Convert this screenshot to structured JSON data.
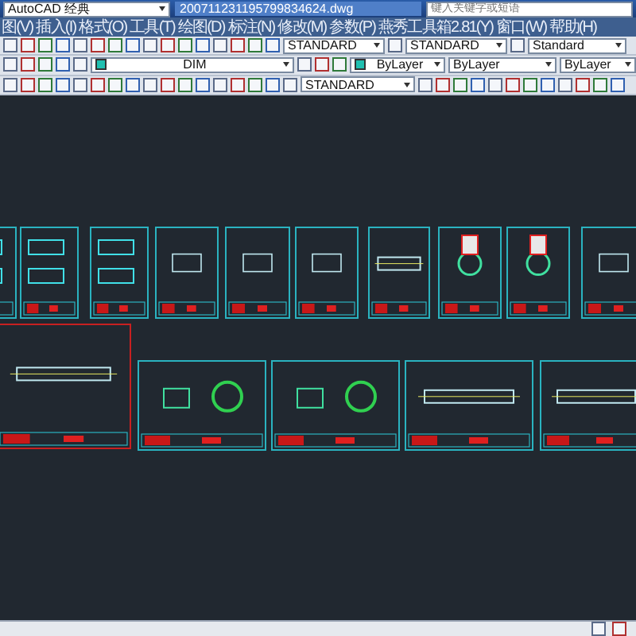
{
  "window": {
    "workspace": "AutoCAD 经典",
    "title": "200711231195799834624.dwg",
    "search": {
      "placeholder": "键入关键字或短语"
    }
  },
  "menu": [
    "图(V)",
    "插入(I)",
    "格式(O)",
    "工具(T)",
    "绘图(D)",
    "标注(N)",
    "修改(M)",
    "参数(P)",
    "燕秀工具箱2.81(Y)",
    "窗口(W)",
    "帮助(H)"
  ],
  "styles": {
    "text_style": "STANDARD",
    "dim_style": "STANDARD",
    "table_style": "Standard",
    "multileader_style": "STANDARD"
  },
  "layer": "DIM",
  "properties": {
    "color_setting": "ByLayer",
    "linetype": "ByLayer",
    "lineweight": "ByLayer"
  }
}
